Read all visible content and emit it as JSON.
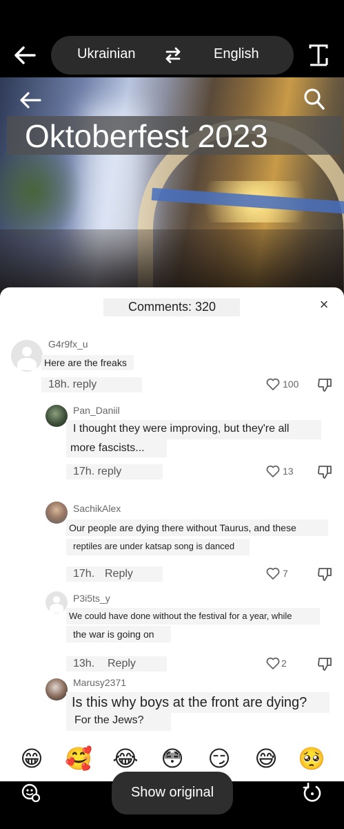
{
  "translate_bar": {
    "source_language": "Ukrainian",
    "target_language": "English"
  },
  "video": {
    "title": "Oktoberfest 2023"
  },
  "comments_panel": {
    "title": "Comments: 320",
    "close_glyph": "×"
  },
  "comments": [
    {
      "username": "G4r9fx_u",
      "text_lines": [
        "Here are the freaks"
      ],
      "time": "18h. reply",
      "reply_label": "",
      "likes": "100"
    },
    {
      "username": "Pan_Daniil",
      "text_lines": [
        "I thought they were improving, but they're all",
        "more fascists..."
      ],
      "time": "17h. reply",
      "reply_label": "",
      "likes": "13"
    },
    {
      "username": "SachikAlex",
      "text_lines": [
        "Our people are dying there without Taurus, and these",
        "reptiles are under katsap song is danced"
      ],
      "time": "17h.",
      "reply_label": "Reply",
      "likes": "7"
    },
    {
      "username": "P3i5ts_y",
      "text_lines": [
        "We could have done without the festival for a year, while",
        "the war is going on"
      ],
      "time": "13h.",
      "reply_label": "Reply",
      "likes": "2"
    },
    {
      "username": "Marusy2371",
      "text_lines": [
        "Is this why boys at the front are dying?",
        "For the Jews?"
      ],
      "time": "",
      "reply_label": "",
      "likes": ""
    }
  ],
  "emoji_bar": [
    "😁",
    "🥰",
    "😂",
    "😳",
    "😏",
    "😅",
    "🥺"
  ],
  "bottom_bar": {
    "show_original_label": "Show original"
  },
  "icons": {
    "top_back": "back-arrow-icon",
    "swap": "swap-arrows-icon",
    "text_mode": "text-mode-icon",
    "video_back": "back-arrow-icon",
    "video_search": "search-icon",
    "like": "heart-icon",
    "dislike": "thumbs-down-icon",
    "bottom_left": "translate-face-icon",
    "bottom_right": "undo-rotate-icon"
  }
}
